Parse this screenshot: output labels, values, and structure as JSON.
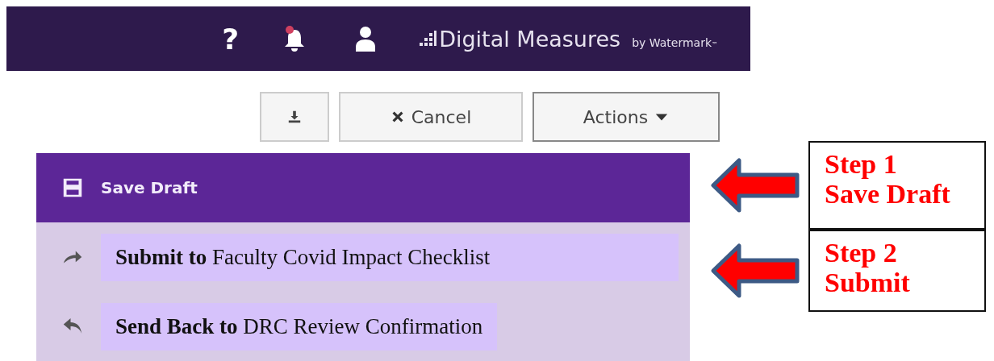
{
  "header": {
    "help": "?",
    "logo": {
      "name": "Digital Measures",
      "by": "by Watermark",
      "tm": "™"
    }
  },
  "toolbar": {
    "buttons": [
      {
        "kind": "download"
      },
      {
        "kind": "cancel",
        "label": "Cancel"
      },
      {
        "kind": "actions",
        "label": "Actions"
      }
    ]
  },
  "actions_menu": {
    "items": [
      {
        "kind": "save",
        "label": "Save Draft",
        "selected": true
      },
      {
        "kind": "forward",
        "label": "**Submit to** Faculty Covid Impact Checklist",
        "selected": false
      },
      {
        "kind": "back",
        "label": "**Send Back to** DRC Review Confirmation",
        "selected": false
      }
    ]
  },
  "callouts": [
    {
      "lines": [
        "Step 1",
        "Save Draft"
      ]
    },
    {
      "lines": [
        "Step 2",
        "Submit"
      ]
    }
  ]
}
